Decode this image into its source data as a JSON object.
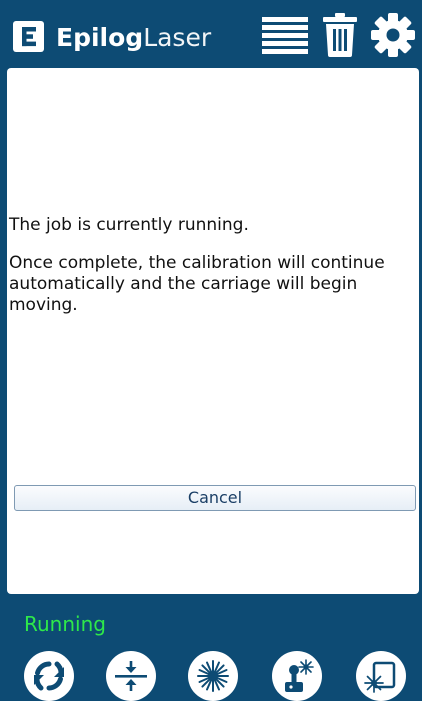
{
  "header": {
    "brand_bold": "Epilog",
    "brand_light": "Laser",
    "icons": [
      "logo-mark-icon",
      "job-list-icon",
      "trash-icon",
      "settings-gear-icon"
    ]
  },
  "message": {
    "line1": "The job is currently running.",
    "line2": "Once complete, the calibration will continue automatically and the carriage will begin moving."
  },
  "actions": {
    "cancel_label": "Cancel"
  },
  "status": {
    "text": "Running",
    "color": "#2ee84a"
  },
  "footer": {
    "buttons": [
      "refresh-icon",
      "focus-icon",
      "laser-icon",
      "joystick-laser-icon",
      "laser-frame-icon"
    ]
  },
  "colors": {
    "brand_blue": "#0d4b74",
    "panel": "#ffffff",
    "button_text": "#1b3f66"
  }
}
